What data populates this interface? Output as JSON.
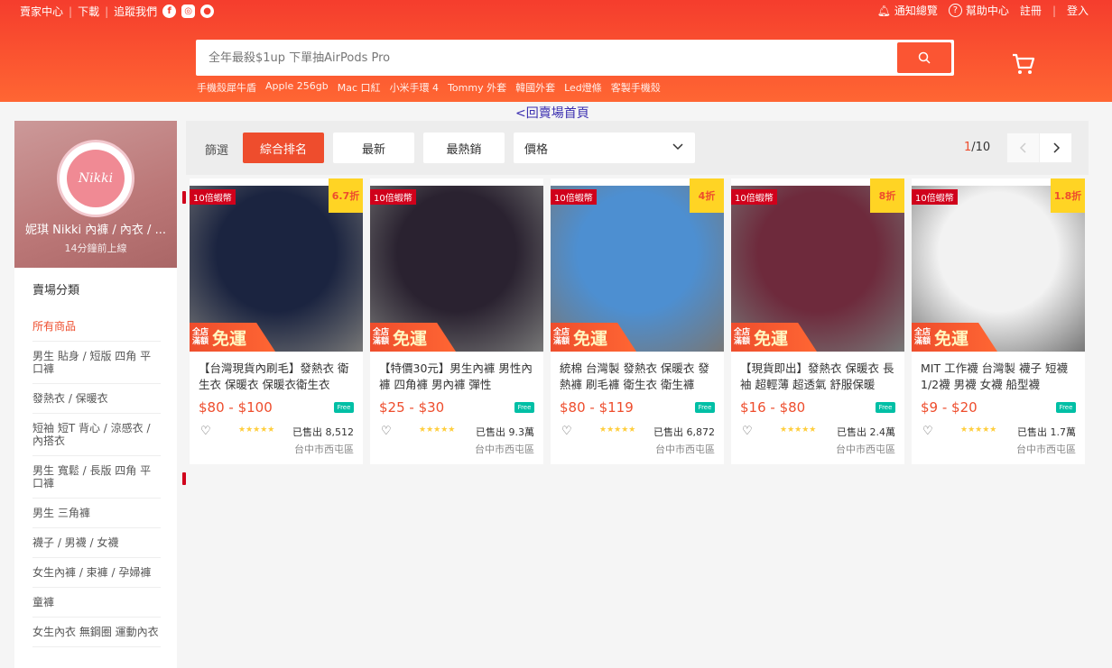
{
  "topbar": {
    "seller_center": "賣家中心",
    "download": "下載",
    "follow_us": "追蹤我們",
    "notifications": "通知總覽",
    "help": "幫助中心",
    "signup": "註冊",
    "login": "登入"
  },
  "search": {
    "placeholder": "全年最殺$1up 下單抽AirPods Pro",
    "hotwords": [
      "手機殼犀牛盾",
      "Apple 256gb",
      "Mac 口紅",
      "小米手環 4",
      "Tommy 外套",
      "韓國外套",
      "Led燈條",
      "客製手機殼"
    ]
  },
  "back_link": "回賣場首頁",
  "shop": {
    "logo_text": "Nikki",
    "name": "妮琪 Nikki 內褲 / 內衣 / ...",
    "online": "14分鐘前上線"
  },
  "categories": {
    "title": "賣場分類",
    "items": [
      "所有商品",
      "男生 貼身 / 短版 四角 平口褲",
      "發熱衣 / 保暖衣",
      "短袖 短T 背心 / 涼感衣 / 內搭衣",
      "男生 寬鬆 / 長版 四角 平口褲",
      "男生 三角褲",
      "襪子 / 男襪 / 女襪",
      "女生內褲 / 束褲 / 孕婦褲",
      "童褲",
      "女生內衣 無鋼圈 運動內衣"
    ]
  },
  "filter": {
    "label": "篩選",
    "sort_relevance": "綜合排名",
    "sort_latest": "最新",
    "sort_top": "最熱銷",
    "sort_price": "價格",
    "page_current": "1",
    "page_total": "/10"
  },
  "promo": {
    "coins": "10倍蝦幣",
    "free_a": "全店滿額",
    "free_b": "免運",
    "free_badge": "Free"
  },
  "products": [
    {
      "discount": "6.7折",
      "title": "【台灣現貨內刷毛】發熱衣 衛生衣 保暖衣 保暖衣衛生衣",
      "price": "$80 - $100",
      "sold": "已售出 8,512",
      "location": "台中市西屯區",
      "stars": "★★★★★",
      "photo_color": "#1b2440"
    },
    {
      "discount": "",
      "title": "【特價30元】男生內褲 男性內褲 四角褲 男內褲 彈性",
      "price": "$25 - $30",
      "sold": "已售出 9.3萬",
      "location": "台中市西屯區",
      "stars": "★★★★★",
      "photo_color": "#2a2230"
    },
    {
      "discount": "4折",
      "title": "統棉 台灣製 發熱衣 保暖衣 發熱褲 刷毛褲 衛生衣 衛生褲",
      "price": "$80 - $119",
      "sold": "已售出 6,872",
      "location": "台中市西屯區",
      "stars": "★★★★★",
      "photo_color": "#4d8fd1"
    },
    {
      "discount": "8折",
      "title": "【現貨即出】發熱衣 保暖衣 長袖 超輕薄 超透氣 舒服保暖",
      "price": "$16 - $80",
      "sold": "已售出 2.4萬",
      "location": "台中市西屯區",
      "stars": "★★★★★",
      "photo_color": "#6e2a3c"
    },
    {
      "discount": "1.8折",
      "title": "MIT 工作襪 台灣製 襪子 短襪 1/2襪 男襪 女襪 船型襪",
      "price": "$9 - $20",
      "sold": "已售出 1.7萬",
      "location": "台中市西屯區",
      "stars": "★★★★★",
      "photo_color": "#f2f2f2"
    }
  ]
}
